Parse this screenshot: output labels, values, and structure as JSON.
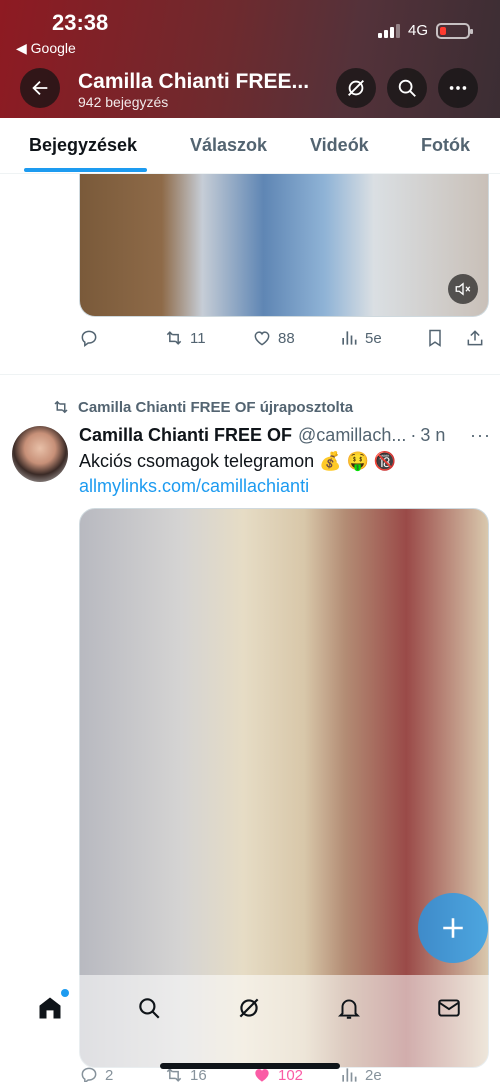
{
  "status": {
    "time": "23:38",
    "back_app": "◀ Google",
    "network": "4G"
  },
  "header": {
    "title": "Camilla Chianti FREE...",
    "post_count": "942 bejegyzés",
    "back_icon": "arrow-left-icon",
    "grok_icon": "grok-icon",
    "search_icon": "search-icon",
    "more_icon": "more-icon"
  },
  "tabs": [
    "Bejegyzések",
    "Válaszok",
    "Videók",
    "Fotók"
  ],
  "post1": {
    "actions": {
      "reply": "",
      "reposts": "11",
      "likes": "88",
      "views": "5e"
    }
  },
  "post2": {
    "repost_label": "Camilla Chianti FREE OF újraposztolta",
    "author_name": "Camilla Chianti FREE OF",
    "handle": "@camillach...",
    "dot": "·",
    "time": "3 n",
    "more": "···",
    "text": "Akciós csomagok telegramon 💰 🤑 🔞",
    "link": "allmylinks.com/camillachianti",
    "actions": {
      "reply": "2",
      "reposts": "16",
      "likes": "102",
      "views": "2e"
    }
  },
  "fab": {
    "icon": "plus-icon"
  },
  "bottom_nav": [
    "home-icon",
    "search-icon",
    "grok-icon",
    "notifications-icon",
    "messages-icon"
  ],
  "colors": {
    "accent": "#1d9bf0",
    "text": "#0f1419",
    "muted": "#536471",
    "header_bg": "#7a2a30"
  }
}
